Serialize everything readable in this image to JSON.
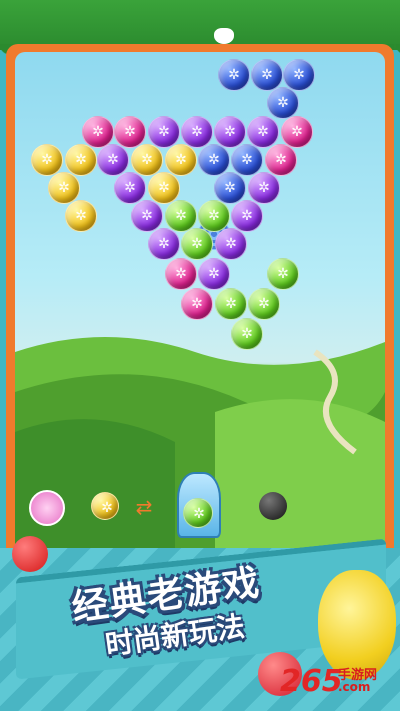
{
  "game": {
    "title_line1": "经典老游戏",
    "title_line2": "时尚新玩法"
  },
  "watermark": {
    "digits": "265",
    "site_name": "手游网",
    "site_url": ".com"
  },
  "colors": {
    "frame": "#f07a2d",
    "banner": "#51bfcb",
    "title_outline": "#2a4a7a",
    "blue": "#2a4fd6",
    "pink": "#e0218f",
    "purple": "#8a2be2",
    "yellow": "#f2c21a",
    "green": "#5fcc1e"
  },
  "bubbles": [
    {
      "color": "blue"
    },
    {
      "color": "blue"
    },
    {
      "color": "blue"
    },
    {
      "color": "blue"
    },
    {
      "color": "pink"
    },
    {
      "color": "pink"
    },
    {
      "color": "purple"
    },
    {
      "color": "purple"
    },
    {
      "color": "purple"
    },
    {
      "color": "purple"
    },
    {
      "color": "pink"
    },
    {
      "color": "yellow"
    },
    {
      "color": "yellow"
    },
    {
      "color": "purple"
    },
    {
      "color": "yellow"
    },
    {
      "color": "yellow"
    },
    {
      "color": "blue"
    },
    {
      "color": "blue"
    },
    {
      "color": "pink"
    },
    {
      "color": "yellow"
    },
    {
      "color": "purple"
    },
    {
      "color": "yellow"
    },
    {
      "color": "blue"
    },
    {
      "color": "purple"
    },
    {
      "color": "yellow"
    },
    {
      "color": "purple"
    },
    {
      "color": "green"
    },
    {
      "color": "green"
    },
    {
      "color": "purple"
    },
    {
      "color": "purple"
    },
    {
      "color": "green"
    },
    {
      "color": "purple"
    },
    {
      "color": "pink"
    },
    {
      "color": "purple"
    },
    {
      "color": "green"
    },
    {
      "color": "pink"
    },
    {
      "color": "green"
    },
    {
      "color": "green"
    },
    {
      "color": "green"
    }
  ],
  "shooter": {
    "current_bubble_color": "green",
    "next_bubble_color": "yellow",
    "icons": [
      "flower-powerup-icon",
      "swap-arrows-icon",
      "cannon-icon",
      "bomb-icon"
    ]
  }
}
